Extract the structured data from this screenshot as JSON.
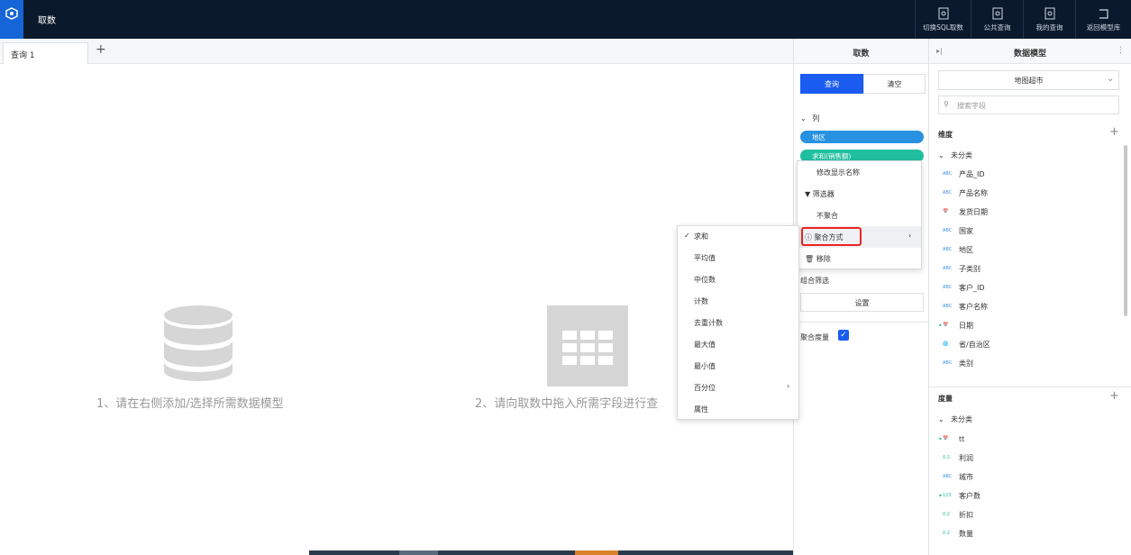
{
  "app": {
    "title": "取数"
  },
  "top_actions": [
    {
      "label": "切换SQL取数",
      "icon": "sql-doc-icon"
    },
    {
      "label": "公共查询",
      "icon": "public-query-icon"
    },
    {
      "label": "我的查询",
      "icon": "my-query-icon"
    },
    {
      "label": "返回模型库",
      "icon": "return-icon"
    }
  ],
  "tabs": [
    {
      "label": "查询 1"
    }
  ],
  "tab_add": "+",
  "workspace": {
    "hint1": "1、请在右侧添加/选择所需数据模型",
    "hint2": "2、请向取数中拖入所需字段进行查"
  },
  "query_panel": {
    "title": "取数",
    "query_button": "查询",
    "clear_button": "清空",
    "columns_title": "列",
    "pills": [
      "地区",
      "求和(销售额)"
    ],
    "combine_filter": "组合筛选",
    "settings_button": "设置",
    "aggregate_measure": "聚合度量"
  },
  "context_menu": [
    "修改显示名称",
    "筛选器",
    "不聚合",
    "聚合方式",
    "移除"
  ],
  "aggregate_menu": [
    {
      "label": "求和",
      "checked": true
    },
    {
      "label": "平均值"
    },
    {
      "label": "中位数"
    },
    {
      "label": "计数"
    },
    {
      "label": "去重计数"
    },
    {
      "label": "最大值"
    },
    {
      "label": "最小值"
    },
    {
      "label": "百分位",
      "has_sub": true
    },
    {
      "label": "属性"
    }
  ],
  "model_panel": {
    "title": "数据模型",
    "model_select": "地图超市",
    "search_placeholder": "搜索字段",
    "dimension_title": "维度",
    "uncategorized": "未分类",
    "dimensions": [
      {
        "type": "ABC",
        "name": "产品_ID"
      },
      {
        "type": "ABC",
        "name": "产品名称"
      },
      {
        "type": "date",
        "name": "发货日期"
      },
      {
        "type": "ABC",
        "name": "国家"
      },
      {
        "type": "ABC",
        "name": "地区"
      },
      {
        "type": "ABC",
        "name": "子类别"
      },
      {
        "type": "ABC",
        "name": "客户_ID"
      },
      {
        "type": "ABC",
        "name": "客户名称"
      },
      {
        "type": "date",
        "name": "日期",
        "dot": true
      },
      {
        "type": "geo",
        "name": "省/自治区"
      },
      {
        "type": "ABC",
        "name": "类别"
      }
    ],
    "measure_title": "度量",
    "measures": [
      {
        "type": "date",
        "name": "tt",
        "dot": true
      },
      {
        "type": "0.2",
        "name": "利润"
      },
      {
        "type": "ABC",
        "name": "城市"
      },
      {
        "type": "123",
        "name": "客户数",
        "dot": true
      },
      {
        "type": "0.2",
        "name": "折扣"
      },
      {
        "type": "0.2",
        "name": "数量"
      }
    ]
  },
  "colors": {
    "accent": "#1a5cf0",
    "topbar": "#0a1a2c",
    "highlight_border": "#e22222",
    "pill_blue": "#2891e0",
    "pill_green": "#1fbf9f"
  }
}
